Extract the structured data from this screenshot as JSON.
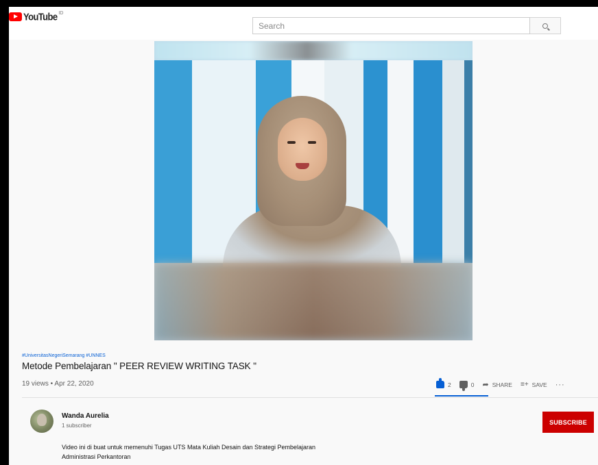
{
  "masthead": {
    "logo_text": "YouTube",
    "logo_sup": "ID",
    "search_placeholder": "Search"
  },
  "video": {
    "hashtags": "#UniversitasNegeriSemarang #UNNES",
    "title": "Metode Pembelajaran \" PEER REVIEW WRITING TASK \"",
    "meta": "19 views • Apr 22, 2020"
  },
  "actions": {
    "likes": "2",
    "dislikes": "0",
    "share_label": "SHARE",
    "save_label": "SAVE",
    "more": "···"
  },
  "channel": {
    "name": "Wanda Aurelia",
    "subscribers": "1 subscriber",
    "subscribe_label": "SUBSCRIBE"
  },
  "description": {
    "line1": "Video ini di buat untuk memenuhi Tugas UTS Mata Kuliah Desain dan Strategi Pembelajaran",
    "line2": "Administrasi Perkantoran"
  },
  "colors": {
    "accent": "#065fd4",
    "subscribe": "#cc0000",
    "brand_red": "#ff0000"
  }
}
